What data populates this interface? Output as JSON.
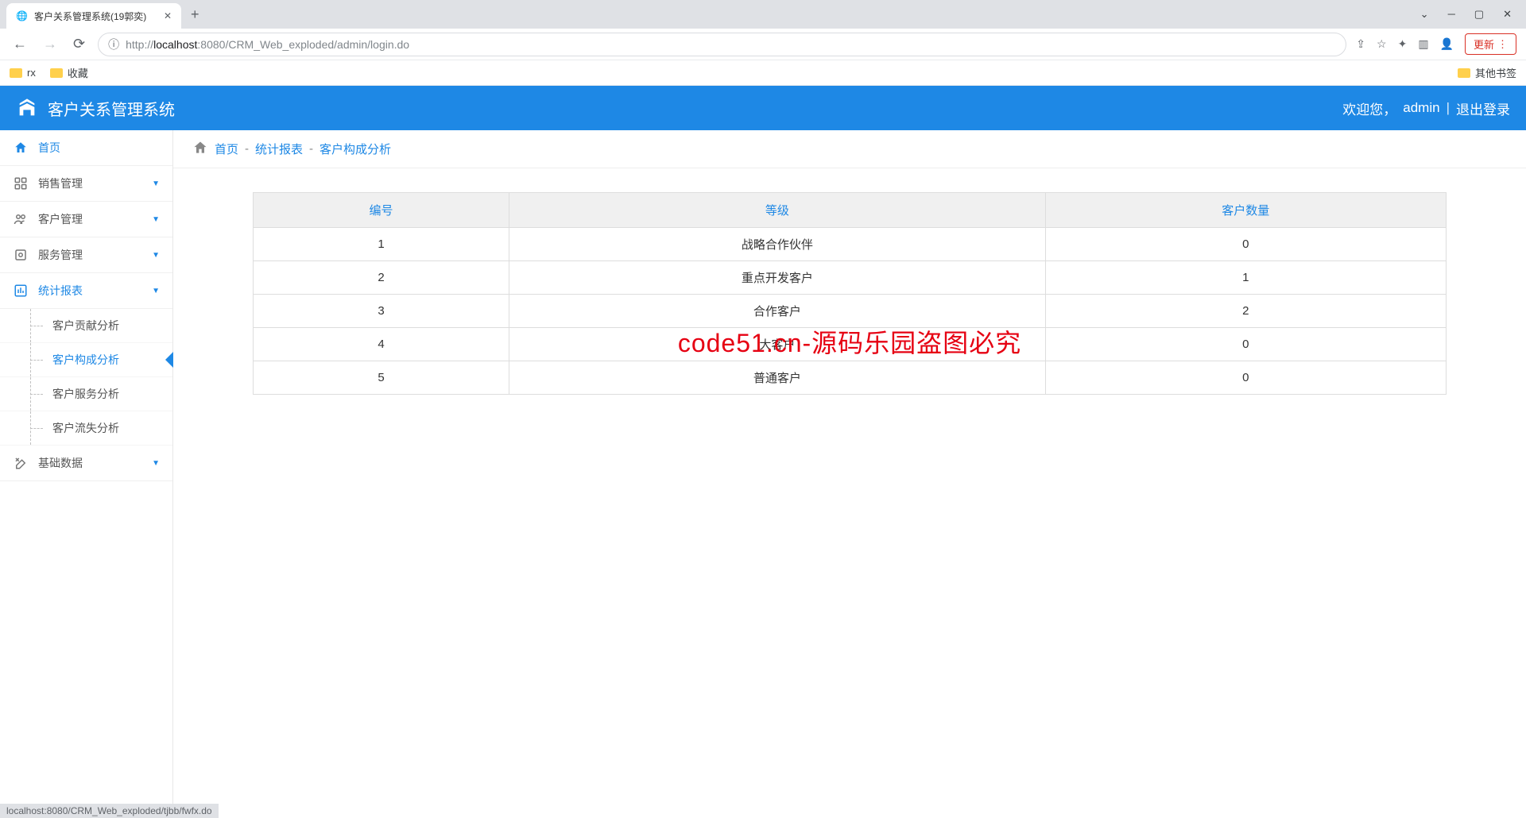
{
  "browser": {
    "tab_title": "客户关系管理系统(19郭奕)",
    "url_prefix": "http://",
    "url_host": "localhost",
    "url_port": ":8080",
    "url_path": "/CRM_Web_exploded/admin/login.do",
    "update_label": "更新",
    "bookmarks": [
      "rx",
      "收藏"
    ],
    "other_bookmarks": "其他书签",
    "status_text": "localhost:8080/CRM_Web_exploded/tjbb/fwfx.do"
  },
  "header": {
    "title": "客户关系管理系统",
    "welcome": "欢迎您，",
    "username": "admin",
    "logout": "退出登录"
  },
  "sidebar": {
    "items": [
      {
        "label": "首页",
        "icon": "home"
      },
      {
        "label": "销售管理",
        "icon": "grid"
      },
      {
        "label": "客户管理",
        "icon": "users"
      },
      {
        "label": "服务管理",
        "icon": "service"
      },
      {
        "label": "统计报表",
        "icon": "chart"
      },
      {
        "label": "基础数据",
        "icon": "tools"
      }
    ],
    "submenu": [
      "客户贡献分析",
      "客户构成分析",
      "客户服务分析",
      "客户流失分析"
    ]
  },
  "breadcrumb": {
    "items": [
      "首页",
      "统计报表",
      "客户构成分析"
    ]
  },
  "table": {
    "headers": [
      "编号",
      "等级",
      "客户数量"
    ],
    "rows": [
      {
        "id": "1",
        "level": "战略合作伙伴",
        "count": "0"
      },
      {
        "id": "2",
        "level": "重点开发客户",
        "count": "1"
      },
      {
        "id": "3",
        "level": "合作客户",
        "count": "2"
      },
      {
        "id": "4",
        "level": "大客户",
        "count": "0"
      },
      {
        "id": "5",
        "level": "普通客户",
        "count": "0"
      }
    ]
  },
  "watermark": "code51.cn-源码乐园盗图必究"
}
